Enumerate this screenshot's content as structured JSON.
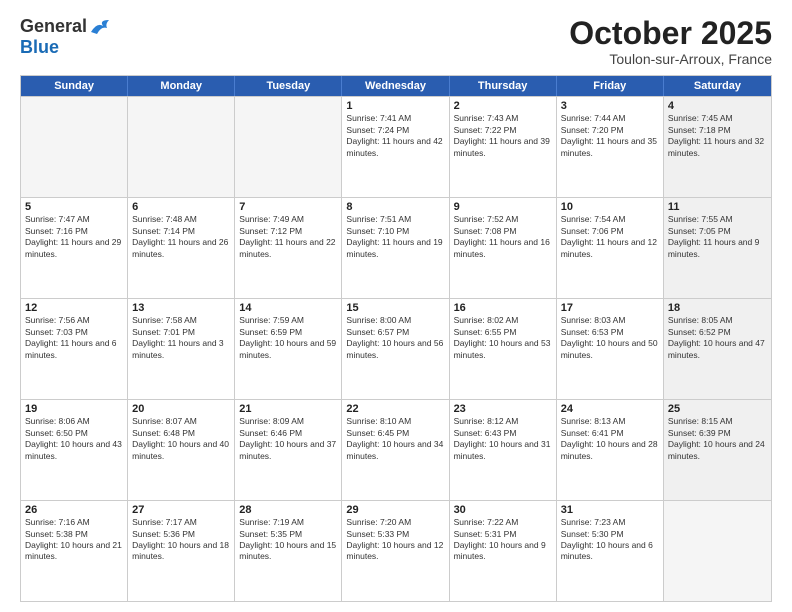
{
  "header": {
    "logo": {
      "general": "General",
      "blue": "Blue"
    },
    "title": "October 2025",
    "subtitle": "Toulon-sur-Arroux, France"
  },
  "weekdays": [
    "Sunday",
    "Monday",
    "Tuesday",
    "Wednesday",
    "Thursday",
    "Friday",
    "Saturday"
  ],
  "weeks": [
    [
      {
        "day": "",
        "empty": true
      },
      {
        "day": "",
        "empty": true
      },
      {
        "day": "",
        "empty": true
      },
      {
        "day": "1",
        "sunrise": "Sunrise: 7:41 AM",
        "sunset": "Sunset: 7:24 PM",
        "daylight": "Daylight: 11 hours and 42 minutes."
      },
      {
        "day": "2",
        "sunrise": "Sunrise: 7:43 AM",
        "sunset": "Sunset: 7:22 PM",
        "daylight": "Daylight: 11 hours and 39 minutes."
      },
      {
        "day": "3",
        "sunrise": "Sunrise: 7:44 AM",
        "sunset": "Sunset: 7:20 PM",
        "daylight": "Daylight: 11 hours and 35 minutes."
      },
      {
        "day": "4",
        "sunrise": "Sunrise: 7:45 AM",
        "sunset": "Sunset: 7:18 PM",
        "daylight": "Daylight: 11 hours and 32 minutes.",
        "shaded": true
      }
    ],
    [
      {
        "day": "5",
        "sunrise": "Sunrise: 7:47 AM",
        "sunset": "Sunset: 7:16 PM",
        "daylight": "Daylight: 11 hours and 29 minutes."
      },
      {
        "day": "6",
        "sunrise": "Sunrise: 7:48 AM",
        "sunset": "Sunset: 7:14 PM",
        "daylight": "Daylight: 11 hours and 26 minutes."
      },
      {
        "day": "7",
        "sunrise": "Sunrise: 7:49 AM",
        "sunset": "Sunset: 7:12 PM",
        "daylight": "Daylight: 11 hours and 22 minutes."
      },
      {
        "day": "8",
        "sunrise": "Sunrise: 7:51 AM",
        "sunset": "Sunset: 7:10 PM",
        "daylight": "Daylight: 11 hours and 19 minutes."
      },
      {
        "day": "9",
        "sunrise": "Sunrise: 7:52 AM",
        "sunset": "Sunset: 7:08 PM",
        "daylight": "Daylight: 11 hours and 16 minutes."
      },
      {
        "day": "10",
        "sunrise": "Sunrise: 7:54 AM",
        "sunset": "Sunset: 7:06 PM",
        "daylight": "Daylight: 11 hours and 12 minutes."
      },
      {
        "day": "11",
        "sunrise": "Sunrise: 7:55 AM",
        "sunset": "Sunset: 7:05 PM",
        "daylight": "Daylight: 11 hours and 9 minutes.",
        "shaded": true
      }
    ],
    [
      {
        "day": "12",
        "sunrise": "Sunrise: 7:56 AM",
        "sunset": "Sunset: 7:03 PM",
        "daylight": "Daylight: 11 hours and 6 minutes."
      },
      {
        "day": "13",
        "sunrise": "Sunrise: 7:58 AM",
        "sunset": "Sunset: 7:01 PM",
        "daylight": "Daylight: 11 hours and 3 minutes."
      },
      {
        "day": "14",
        "sunrise": "Sunrise: 7:59 AM",
        "sunset": "Sunset: 6:59 PM",
        "daylight": "Daylight: 10 hours and 59 minutes."
      },
      {
        "day": "15",
        "sunrise": "Sunrise: 8:00 AM",
        "sunset": "Sunset: 6:57 PM",
        "daylight": "Daylight: 10 hours and 56 minutes."
      },
      {
        "day": "16",
        "sunrise": "Sunrise: 8:02 AM",
        "sunset": "Sunset: 6:55 PM",
        "daylight": "Daylight: 10 hours and 53 minutes."
      },
      {
        "day": "17",
        "sunrise": "Sunrise: 8:03 AM",
        "sunset": "Sunset: 6:53 PM",
        "daylight": "Daylight: 10 hours and 50 minutes."
      },
      {
        "day": "18",
        "sunrise": "Sunrise: 8:05 AM",
        "sunset": "Sunset: 6:52 PM",
        "daylight": "Daylight: 10 hours and 47 minutes.",
        "shaded": true
      }
    ],
    [
      {
        "day": "19",
        "sunrise": "Sunrise: 8:06 AM",
        "sunset": "Sunset: 6:50 PM",
        "daylight": "Daylight: 10 hours and 43 minutes."
      },
      {
        "day": "20",
        "sunrise": "Sunrise: 8:07 AM",
        "sunset": "Sunset: 6:48 PM",
        "daylight": "Daylight: 10 hours and 40 minutes."
      },
      {
        "day": "21",
        "sunrise": "Sunrise: 8:09 AM",
        "sunset": "Sunset: 6:46 PM",
        "daylight": "Daylight: 10 hours and 37 minutes."
      },
      {
        "day": "22",
        "sunrise": "Sunrise: 8:10 AM",
        "sunset": "Sunset: 6:45 PM",
        "daylight": "Daylight: 10 hours and 34 minutes."
      },
      {
        "day": "23",
        "sunrise": "Sunrise: 8:12 AM",
        "sunset": "Sunset: 6:43 PM",
        "daylight": "Daylight: 10 hours and 31 minutes."
      },
      {
        "day": "24",
        "sunrise": "Sunrise: 8:13 AM",
        "sunset": "Sunset: 6:41 PM",
        "daylight": "Daylight: 10 hours and 28 minutes."
      },
      {
        "day": "25",
        "sunrise": "Sunrise: 8:15 AM",
        "sunset": "Sunset: 6:39 PM",
        "daylight": "Daylight: 10 hours and 24 minutes.",
        "shaded": true
      }
    ],
    [
      {
        "day": "26",
        "sunrise": "Sunrise: 7:16 AM",
        "sunset": "Sunset: 5:38 PM",
        "daylight": "Daylight: 10 hours and 21 minutes."
      },
      {
        "day": "27",
        "sunrise": "Sunrise: 7:17 AM",
        "sunset": "Sunset: 5:36 PM",
        "daylight": "Daylight: 10 hours and 18 minutes."
      },
      {
        "day": "28",
        "sunrise": "Sunrise: 7:19 AM",
        "sunset": "Sunset: 5:35 PM",
        "daylight": "Daylight: 10 hours and 15 minutes."
      },
      {
        "day": "29",
        "sunrise": "Sunrise: 7:20 AM",
        "sunset": "Sunset: 5:33 PM",
        "daylight": "Daylight: 10 hours and 12 minutes."
      },
      {
        "day": "30",
        "sunrise": "Sunrise: 7:22 AM",
        "sunset": "Sunset: 5:31 PM",
        "daylight": "Daylight: 10 hours and 9 minutes."
      },
      {
        "day": "31",
        "sunrise": "Sunrise: 7:23 AM",
        "sunset": "Sunset: 5:30 PM",
        "daylight": "Daylight: 10 hours and 6 minutes."
      },
      {
        "day": "",
        "empty": true,
        "shaded": true
      }
    ]
  ]
}
